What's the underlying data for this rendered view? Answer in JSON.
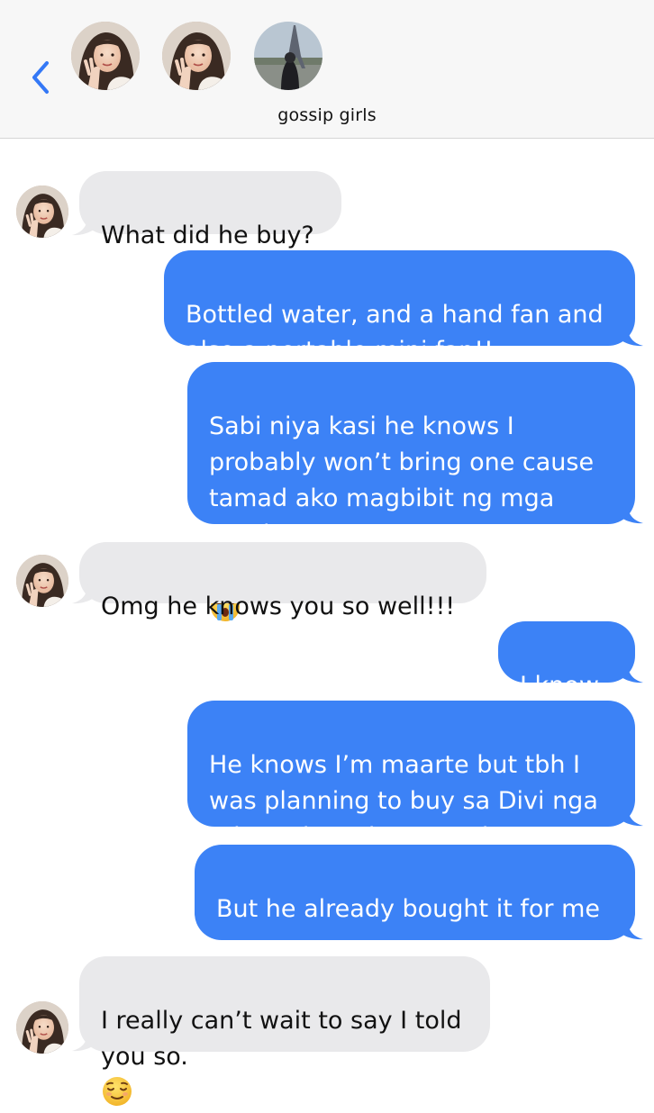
{
  "header": {
    "back_icon": "chevron-left-icon",
    "group_name": "gossip girls",
    "avatars": [
      "girl-peace-sign-photo",
      "girl-peace-sign-photo-2",
      "eiffel-tower-photo"
    ]
  },
  "colors": {
    "outgoing": "#3c82f6",
    "incoming": "#e9e9eb",
    "accent": "#3478f6"
  },
  "messages": [
    {
      "direction": "incoming",
      "text": "What did he buy?"
    },
    {
      "direction": "outgoing",
      "text": "Bottled water, and a hand fan and\nalso a portable mini fan!!"
    },
    {
      "direction": "outgoing",
      "text": "Sabi niya kasi he knows I\nprobably won’t bring one cause\ntamad ako magbibit ng mga\ngamit LOL",
      "emojis": [
        "😂",
        "😭"
      ]
    },
    {
      "direction": "incoming",
      "text": "Omg he knows you so well!!!"
    },
    {
      "direction": "outgoing",
      "text": "I know."
    },
    {
      "direction": "outgoing",
      "text": "He knows I’m maarte but tbh I\nwas planning to buy sa Divi nga\ntalaga those items na lang",
      "emojis": [
        "😅"
      ]
    },
    {
      "direction": "outgoing",
      "text": "But he already bought it for me\n",
      "emojis": [
        "😭",
        "😭"
      ]
    },
    {
      "direction": "incoming",
      "text": "I really can’t wait to say I told\nyou so.",
      "emojis": [
        "😌"
      ]
    }
  ]
}
